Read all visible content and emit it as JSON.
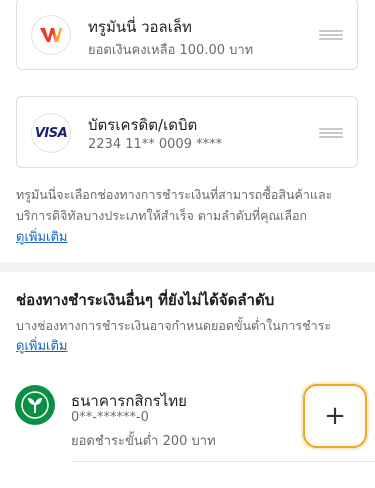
{
  "payment_methods": {
    "wallet": {
      "title": "ทรูมันนี่ วอลเล็ท",
      "subtitle": "ยอดเงินคงเหลือ 100.00 บาท",
      "logo_colors": [
        "#e8392b",
        "#f5a623"
      ]
    },
    "credit": {
      "title": "บัตรเครดิต/เดบิต",
      "subtitle": "2234 11** 0009  ****",
      "logo_text": "VISA"
    }
  },
  "info": {
    "text": "ทรูมันนี่จะเลือกช่องทางการชำระเงินที่สามารถซื้อสินค้าและบริการดิจิทัลบางประเภทให้สำเร็จ ตามลำดับที่คุณเลือก",
    "link": "ดูเพิ่มเติม"
  },
  "other_section": {
    "title": "ช่องทางชำระเงินอื่นๆ ที่ยังไม่ได้จัดลำดับ",
    "description": "บางช่องทางการชำระเงินอาจกำหนดยอดขั้นต่ำในการชำระ",
    "link": "ดูเพิ่มเติม"
  },
  "bank": {
    "name": "ธนาคารกสิกรไทย",
    "account": "0**-******-0",
    "min_payment": "ยอดชำระขั้นต่ำ 200 บาท",
    "color": "#0a8f45"
  },
  "add_button": {
    "label": "+",
    "border_color": "#f5a623"
  }
}
